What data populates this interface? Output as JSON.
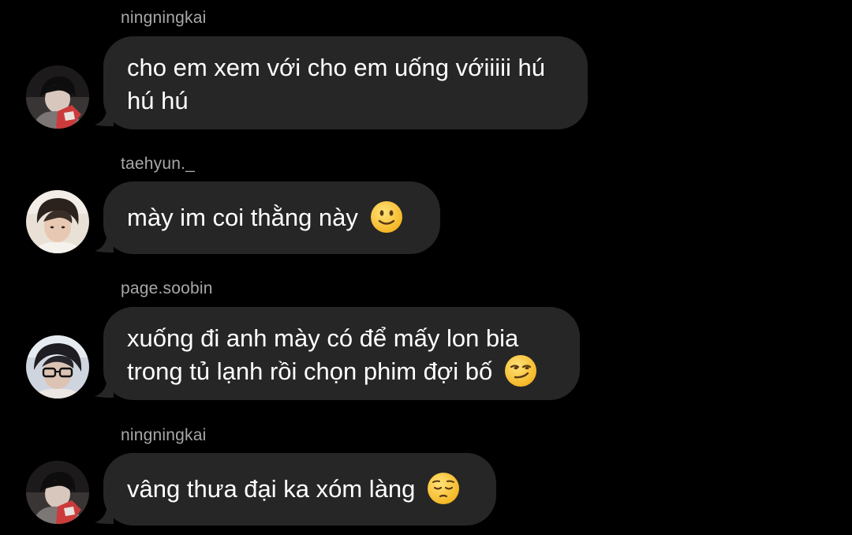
{
  "messages": [
    {
      "sender": "ningningkai",
      "avatar_icon": "user-avatar-icon",
      "lines": [
        "cho em xem với cho em uống vớiiiii hú",
        "hú hú"
      ],
      "emoji": ""
    },
    {
      "sender": "taehyun._",
      "avatar_icon": "user-avatar-icon",
      "lines": [
        "mày im coi thằng này"
      ],
      "emoji": "slightly-smiling-face-emoji"
    },
    {
      "sender": "page.soobin",
      "avatar_icon": "user-avatar-icon",
      "lines": [
        "xuống đi anh mày có để mấy lon bia",
        "trong tủ lạnh rồi chọn phim đợi bố"
      ],
      "emoji": "smirking-face-emoji"
    },
    {
      "sender": "ningningkai",
      "avatar_icon": "user-avatar-icon",
      "lines": [
        "vâng thưa đại ka xóm làng"
      ],
      "emoji": "pensive-face-emoji"
    }
  ],
  "colors": {
    "background": "#000000",
    "bubble": "#262626",
    "sender_text": "#a8a8a8",
    "message_text": "#ffffff",
    "emoji": "#ffcc33"
  }
}
